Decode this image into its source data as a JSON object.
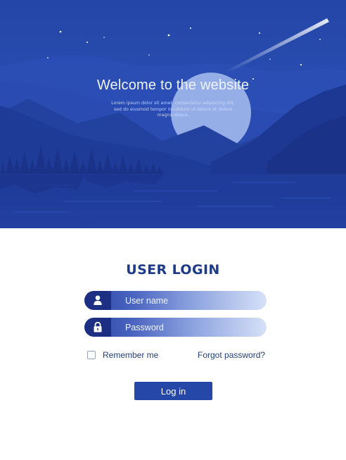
{
  "hero": {
    "title": "Welcome to the website",
    "lorem": "Lorem ipsum dolor sit amet, consectetur adipiscing elit, sed do eiusmod tempor incididunt ut labore et dolore magna aliqua."
  },
  "login": {
    "title": "USER LOGIN",
    "username": {
      "placeholder": "User name",
      "icon": "user-icon"
    },
    "password": {
      "placeholder": "Password",
      "icon": "lock-icon"
    },
    "remember_label": "Remember me",
    "remember_checked": false,
    "forgot_label": "Forgot password?",
    "submit_label": "Log in"
  },
  "colors": {
    "hero_sky": "#2244a8",
    "accent": "#2447a8",
    "title": "#1d3a8a",
    "icon_bg": "#1c2f82"
  }
}
